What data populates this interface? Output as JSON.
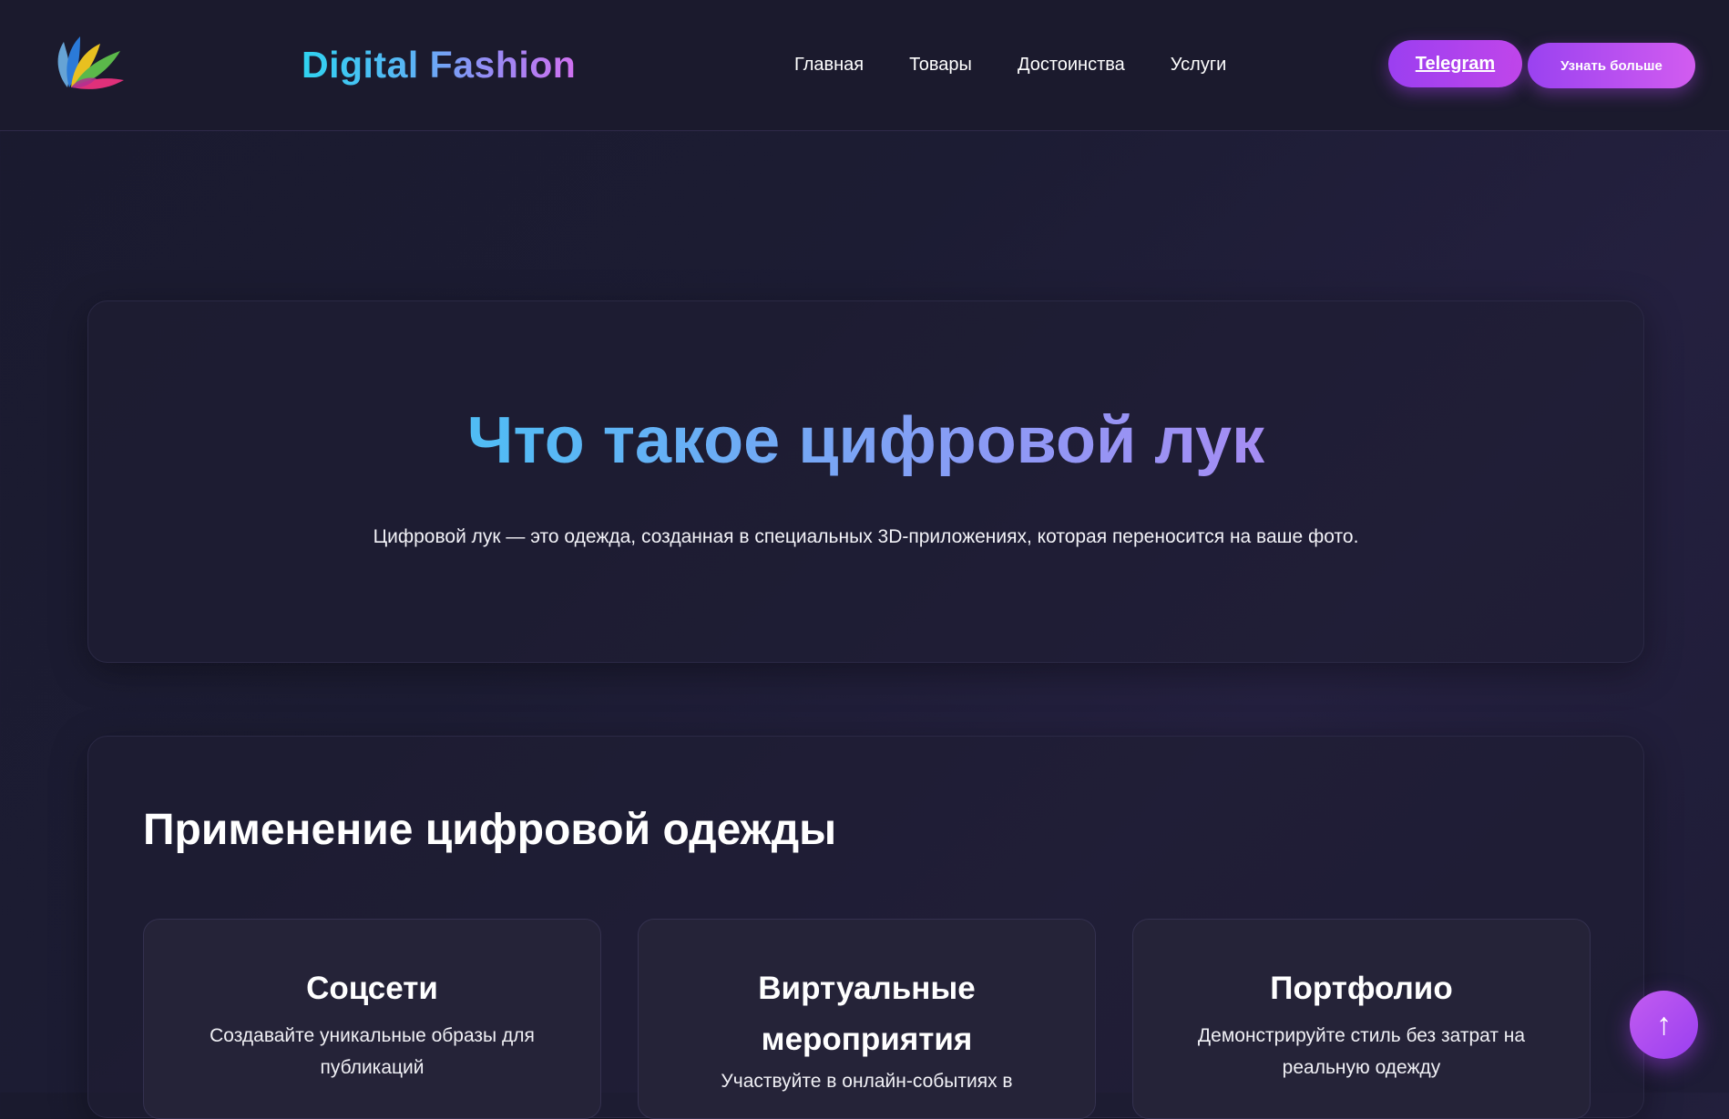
{
  "header": {
    "brand": "Digital Fashion",
    "nav": [
      {
        "label": "Главная"
      },
      {
        "label": "Товары"
      },
      {
        "label": "Достоинства"
      },
      {
        "label": "Услуги"
      }
    ],
    "telegram_label": "Telegram",
    "more_label": "Узнать больше"
  },
  "hero": {
    "title": "Что такое цифровой лук",
    "subtitle": "Цифровой лук — это одежда, созданная в специальных 3D-приложениях, которая переносится на ваше фото."
  },
  "applications": {
    "title": "Применение цифровой одежды",
    "cards": [
      {
        "title": "Соцсети",
        "description": "Создавайте уникальные образы для публикаций"
      },
      {
        "title": "Виртуальные мероприятия",
        "description": "Участвуйте в онлайн-событиях в"
      },
      {
        "title": "Портфолио",
        "description": "Демонстрируйте стиль без затрат на реальную одежду"
      }
    ]
  },
  "scroll_top": {
    "icon": "arrow-up-icon",
    "glyph": "↑"
  },
  "colors": {
    "background": "#1a1a2e",
    "accent_purple": "#9b3ff0",
    "accent_pink": "#d25cf0",
    "accent_cyan": "#2bd0f2"
  }
}
